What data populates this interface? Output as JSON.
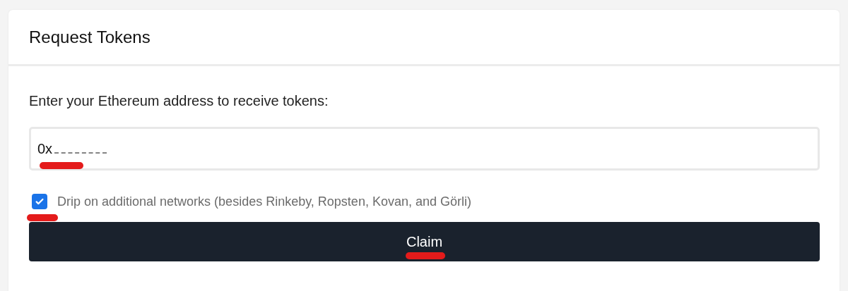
{
  "card": {
    "title": "Request Tokens"
  },
  "form": {
    "label": "Enter your Ethereum address to receive tokens:",
    "address": {
      "value": "0x"
    },
    "option": {
      "label": "Drip on additional networks (besides Rinkeby, Ropsten, Kovan, and Görli)",
      "checked": true
    },
    "button": "Claim"
  }
}
